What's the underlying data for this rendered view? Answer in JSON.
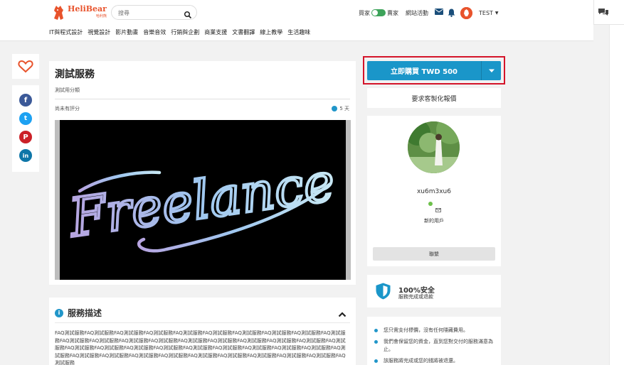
{
  "header": {
    "logo_text": "HeliBear",
    "logo_sub": "哈利熊",
    "search": {
      "placeholder": "搜尋"
    },
    "mode_buyer": "買家",
    "mode_seller": "賣家",
    "activity_label": "網站活動",
    "user_name": "TEST"
  },
  "categories": [
    "IT與程式設計",
    "視覺設計",
    "影片動畫",
    "音樂音效",
    "行銷與企劃",
    "商業支援",
    "文書翻譯",
    "線上教學",
    "生活趣味"
  ],
  "social": {
    "facebook": "f",
    "twitter": "t",
    "pinterest": "P",
    "linkedin": "in"
  },
  "service": {
    "title": "測試服務",
    "category": "測試用分類",
    "rating_text": "尚未有評分",
    "delivery": "5 天",
    "hero_word": "Freelance"
  },
  "description": {
    "heading": "服務描述",
    "body": "FAQ測試服務FAQ測試服務FAQ測試服務FAQ測試服務FAQ測試服務FAQ測試服務FAQ測試服務FAQ測試服務FAQ測試服務FAQ測試服務FAQ測試服務FAQ測試服務FAQ測試服務FAQ測試服務FAQ測試服務FAQ測試服務FAQ測試服務FAQ測試服務FAQ測試服務FAQ測試服務FAQ測試服務FAQ測試服務FAQ測試服務FAQ測試服務FAQ測試服務FAQ測試服務FAQ測試服務FAQ測試服務FAQ測試服務FAQ測試服務FAQ測試服務FAQ測試服務FAQ測試服務FAQ測試服務FAQ測試服務FAQ測試服務FAQ測試服務FAQ測試服務FAQ測試服務FAQ測試服務"
  },
  "purchase": {
    "buy_label": "立即購買 TWD 500",
    "custom_quote_label": "要求客製化報價"
  },
  "seller": {
    "name": "xu6m3xu6",
    "level": "新的用戶",
    "contact_label": "聯繫"
  },
  "safety": {
    "title": "100%安全",
    "subtitle": "服務完成或退款"
  },
  "guarantees": [
    "您只需支付標價，沒有任何隱藏費用。",
    "我們會保留您的資金，直到您對交付的服務滿意為止。",
    "該服務將完成或您的錢將被退還。"
  ],
  "colors": {
    "primary": "#1a96c9",
    "brand": "#e8532c",
    "highlight": "#d4142a"
  }
}
